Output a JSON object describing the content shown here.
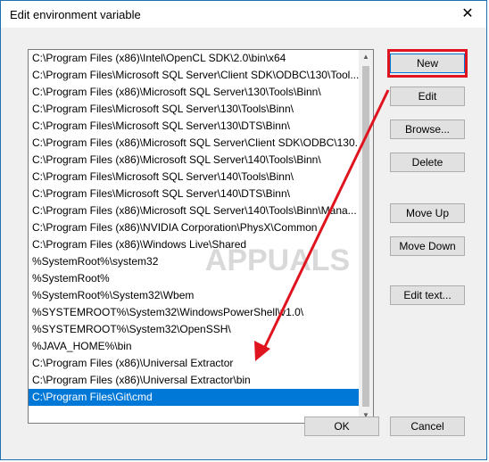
{
  "window": {
    "title": "Edit environment variable",
    "close_label": "✕"
  },
  "paths": [
    "C:\\Program Files (x86)\\Intel\\OpenCL SDK\\2.0\\bin\\x64",
    "C:\\Program Files\\Microsoft SQL Server\\Client SDK\\ODBC\\130\\Tool...",
    "C:\\Program Files (x86)\\Microsoft SQL Server\\130\\Tools\\Binn\\",
    "C:\\Program Files\\Microsoft SQL Server\\130\\Tools\\Binn\\",
    "C:\\Program Files\\Microsoft SQL Server\\130\\DTS\\Binn\\",
    "C:\\Program Files (x86)\\Microsoft SQL Server\\Client SDK\\ODBC\\130...",
    "C:\\Program Files (x86)\\Microsoft SQL Server\\140\\Tools\\Binn\\",
    "C:\\Program Files\\Microsoft SQL Server\\140\\Tools\\Binn\\",
    "C:\\Program Files\\Microsoft SQL Server\\140\\DTS\\Binn\\",
    "C:\\Program Files (x86)\\Microsoft SQL Server\\140\\Tools\\Binn\\Mana...",
    "C:\\Program Files (x86)\\NVIDIA Corporation\\PhysX\\Common",
    "C:\\Program Files (x86)\\Windows Live\\Shared",
    "%SystemRoot%\\system32",
    "%SystemRoot%",
    "%SystemRoot%\\System32\\Wbem",
    "%SYSTEMROOT%\\System32\\WindowsPowerShell\\v1.0\\",
    "%SYSTEMROOT%\\System32\\OpenSSH\\",
    "%JAVA_HOME%\\bin",
    "C:\\Program Files (x86)\\Universal Extractor",
    "C:\\Program Files (x86)\\Universal Extractor\\bin",
    "C:\\Program Files\\Git\\cmd"
  ],
  "selected_index": 20,
  "buttons": {
    "new": "New",
    "edit": "Edit",
    "browse": "Browse...",
    "delete": "Delete",
    "move_up": "Move Up",
    "move_down": "Move Down",
    "edit_text": "Edit text...",
    "ok": "OK",
    "cancel": "Cancel"
  },
  "annotation": {
    "color": "#e0141e"
  },
  "watermark": {
    "text": "APPUALS"
  },
  "colors": {
    "selection": "#0078d7",
    "window_border": "#1f6fb2"
  }
}
